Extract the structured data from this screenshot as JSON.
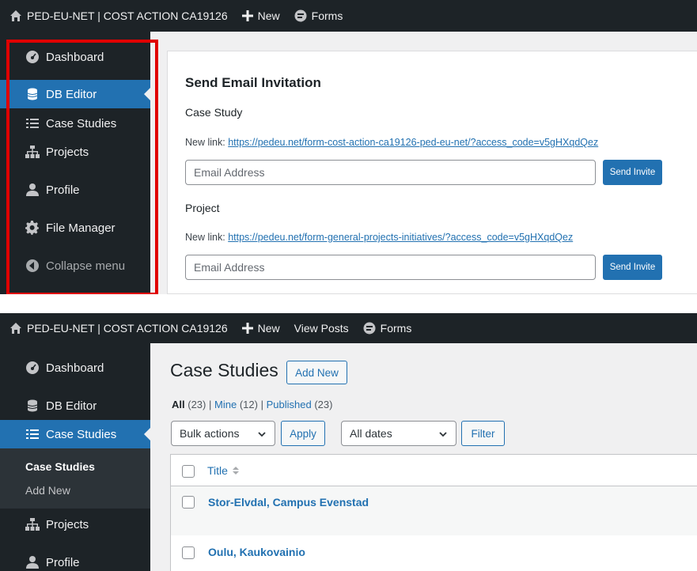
{
  "top": {
    "site_name": "PED-EU-NET | COST ACTION CA19126",
    "new_label": "New",
    "forms_label": "Forms",
    "sidebar": {
      "dashboard": "Dashboard",
      "db_editor": "DB Editor",
      "case_studies": "Case Studies",
      "projects": "Projects",
      "profile": "Profile",
      "file_manager": "File Manager",
      "collapse": "Collapse menu"
    },
    "card": {
      "title": "Send Email Invitation",
      "case_study_label": "Case Study",
      "case_study_link_prefix": "New link:",
      "case_study_link": "https://pedeu.net/form-cost-action-ca19126-ped-eu-net/?access_code=v5gHXqdQez",
      "email_placeholder": "Email Address",
      "send_invite": "Send Invite",
      "project_label": "Project",
      "project_link_prefix": "New link:",
      "project_link": "https://pedeu.net/form-general-projects-initiatives/?access_code=v5gHXqdQez"
    }
  },
  "bottom": {
    "site_name": "PED-EU-NET | COST ACTION CA19126",
    "new_label": "New",
    "view_posts": "View Posts",
    "forms_label": "Forms",
    "sidebar": {
      "dashboard": "Dashboard",
      "db_editor": "DB Editor",
      "case_studies": "Case Studies",
      "sub_case_studies": "Case Studies",
      "sub_add_new": "Add New",
      "projects": "Projects",
      "profile": "Profile"
    },
    "page_title": "Case Studies",
    "add_new": "Add New",
    "filters": {
      "all": "All",
      "all_count": "(23)",
      "mine": "Mine",
      "mine_count": "(12)",
      "published": "Published",
      "published_count": "(23)",
      "sep": "|"
    },
    "bulk_actions": "Bulk actions",
    "apply": "Apply",
    "all_dates": "All dates",
    "filter": "Filter",
    "table": {
      "col_title": "Title",
      "rows": [
        "Stor-Elvdal, Campus Evenstad",
        "Oulu, Kaukovainio"
      ]
    }
  },
  "colors": {
    "adminbar": "#1d2327",
    "accent": "#2271b1",
    "highlight": "#e00000"
  }
}
